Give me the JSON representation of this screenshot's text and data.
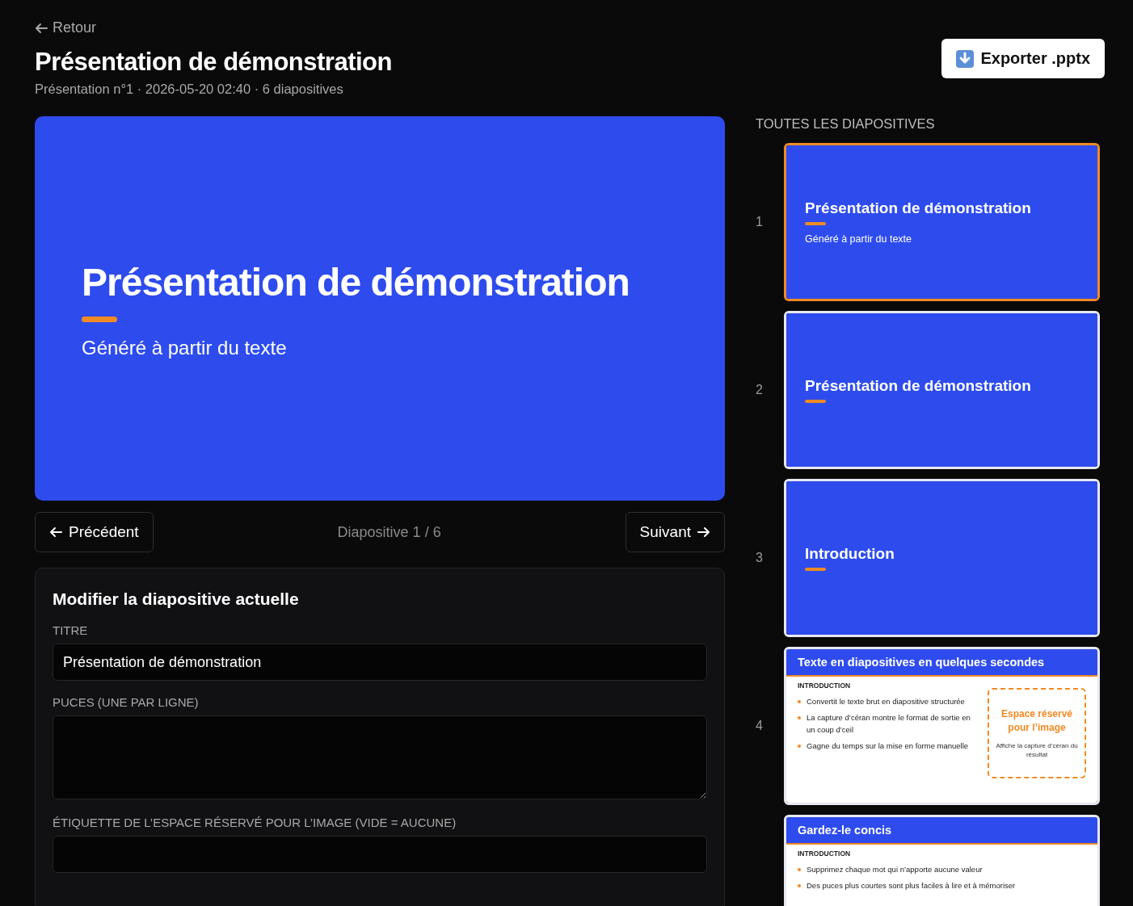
{
  "back_link": "Retour",
  "title": "Présentation de démonstration",
  "meta": "Présentation n°1 · 2026-05-20 02:40 · 6 diapositives",
  "export_button": "Exporter .pptx",
  "current_slide": {
    "title": "Présentation de démonstration",
    "subtitle": "Généré à partir du texte"
  },
  "nav": {
    "prev": "Précédent",
    "counter": "Diapositive 1 / 6",
    "next": "Suivant"
  },
  "editor": {
    "heading": "Modifier la diapositive actuelle",
    "fields": [
      {
        "kind": "input",
        "label": "TITRE",
        "value": "Présentation de démonstration"
      },
      {
        "kind": "textarea",
        "label": "PUCES (UNE PAR LIGNE)"
      },
      {
        "kind": "input",
        "label": "ÉTIQUETTE DE L’ESPACE RÉSERVÉ POUR L’IMAGE (VIDE = AUCUNE)"
      }
    ]
  },
  "sidebar": {
    "heading": "TOUTES LES DIAPOSITIVES",
    "slides": [
      {
        "number": "1",
        "kind": "title",
        "selected": true,
        "title": "Présentation de démonstration",
        "subtitle": "Généré à partir du texte"
      },
      {
        "number": "2",
        "kind": "section",
        "selected": false,
        "title": "Présentation de démonstration"
      },
      {
        "number": "3",
        "kind": "section",
        "selected": false,
        "title": "Introduction"
      },
      {
        "number": "4",
        "kind": "content",
        "selected": false,
        "title": "Texte en diapositives en quelques secondes",
        "section": "INTRODUCTION",
        "bullets": [
          "Convertit le texte brut en diapositive structurée",
          "La capture d’céran montre le format de sortie en un coup d’ceil",
          "Gagne du temps sur la mise en forme manuelle"
        ],
        "image": {
          "label": "Espace réservé pour l’image",
          "caption": "Affiche la capture d’céran du résultat"
        }
      },
      {
        "kind": "content",
        "selected": false,
        "title": "Gardez-le concis",
        "section": "INTRODUCTION",
        "bullets": [
          "Supprimez chaque mot qui n’apporte aucune valeur",
          "Des puces plus courtes sont plus faciles à lire et à mémoriser"
        ]
      }
    ]
  }
}
